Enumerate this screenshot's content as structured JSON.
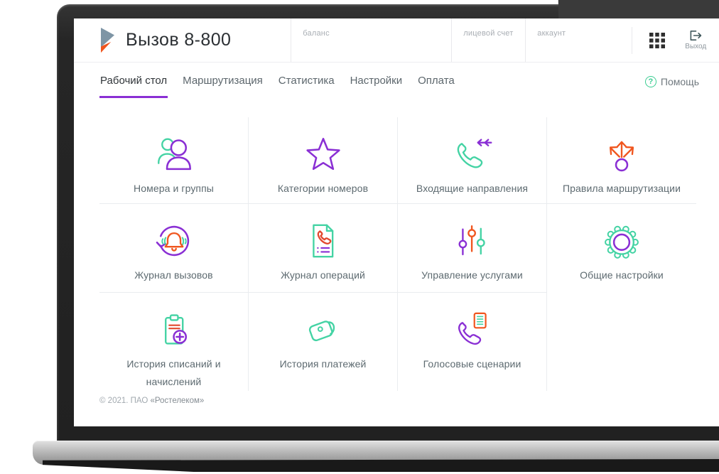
{
  "header": {
    "app_title": "Вызов 8-800",
    "logo_icon": "rostelecom-logo-icon",
    "fields": [
      {
        "label": "баланс"
      },
      {
        "label": "лицевой счет"
      },
      {
        "label": "аккаунт"
      }
    ],
    "apps_grid_icon": "apps-grid-icon",
    "logout": {
      "label": "Выход",
      "icon": "logout-icon"
    }
  },
  "nav": {
    "tabs": [
      {
        "label": "Рабочий стол",
        "active": true
      },
      {
        "label": "Маршрутизация",
        "active": false
      },
      {
        "label": "Статистика",
        "active": false
      },
      {
        "label": "Настройки",
        "active": false
      },
      {
        "label": "Оплата",
        "active": false
      }
    ],
    "help": {
      "label": "Помощь",
      "icon": "question-circle-icon"
    }
  },
  "tiles": [
    {
      "label": "Номера и группы",
      "icon": "people-icon"
    },
    {
      "label": "Категории номеров",
      "icon": "star-icon"
    },
    {
      "label": "Входящие направления",
      "icon": "incoming-call-icon"
    },
    {
      "label": "Правила маршрутизации",
      "icon": "routing-arrows-icon"
    },
    {
      "label": "Журнал вызовов",
      "icon": "call-log-bell-icon"
    },
    {
      "label": "Журнал операций",
      "icon": "operations-document-icon"
    },
    {
      "label": "Управление услугами",
      "icon": "sliders-icon"
    },
    {
      "label": "Общие настройки",
      "icon": "gear-icon"
    },
    {
      "label": "История списаний и начислений",
      "icon": "clipboard-plus-icon"
    },
    {
      "label": "История платежей",
      "icon": "wallet-icon"
    },
    {
      "label": "Голосовые сценарии",
      "icon": "voice-script-phone-icon"
    }
  ],
  "footer": {
    "copyright_prefix": "© 2021. ПАО ",
    "company": "«Ростелеком»"
  },
  "colors": {
    "accent_purple": "#8a2fd4",
    "accent_green": "#44d3a4",
    "accent_orange": "#f0561f",
    "logo_slate": "#7e95a5"
  }
}
